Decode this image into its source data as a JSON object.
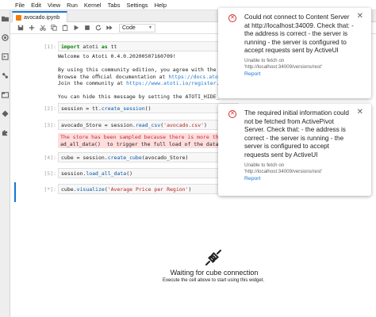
{
  "menu": [
    "File",
    "Edit",
    "View",
    "Run",
    "Kernel",
    "Tabs",
    "Settings",
    "Help"
  ],
  "tab": {
    "label": "avocado.ipynb"
  },
  "toolbar": {
    "cell_type": "Code"
  },
  "left_icons": [
    "folder-icon",
    "running-icon",
    "commands-icon",
    "property-icon",
    "tabs-icon",
    "git-icon",
    "extension-icon"
  ],
  "cells": {
    "c1": {
      "prompt": "[1]:",
      "code_kw": "import",
      "code_mod": " atoti ",
      "code_as": "as",
      "code_alias": " tt",
      "out1": "Welcome to Atoti 0.4.0.20200507160709!",
      "out2": "By using this community edition, you agree with the li",
      "out3_pre": "Browse the o",
      "out3_mid": "ﬃcial documentation at ",
      "out3_link": "https://docs.atoti",
      "out4_pre": "Join the community at ",
      "out4_link": "https://www.atoti.io/register",
      "out4_post": ".",
      "out5": "You can hide this message by setting the ATOTI_HIDE_EU"
    },
    "c2": {
      "prompt": "[2]:",
      "pre": "session = tt.",
      "fn": "create_session",
      "post": "()"
    },
    "c3": {
      "prompt": "[3]:",
      "pre": "avocado_Store = session.",
      "fn": "read_csv",
      "open": "(",
      "str": "'avocado.csv'",
      "close": ")",
      "err1": "The store has been sampled because there is more than",
      "err2": "ad_all_data()  to trigger the full load of the data."
    },
    "c4": {
      "prompt": "[4]:",
      "pre": "cube = session.",
      "fn": "create_cube",
      "post": "(avocado_Store)"
    },
    "c5": {
      "prompt": "[5]:",
      "pre": "session.",
      "fn": "load_all_data",
      "post": "()"
    },
    "c6": {
      "prompt": "[*]:",
      "pre": "cube.",
      "fn": "visualize",
      "open": "(",
      "str": "'Average Price per Region'",
      "close": ")"
    }
  },
  "placeholder": {
    "title": "Waiting for cube connection",
    "subtitle": "Execute the cell above to start using this widget."
  },
  "notifications": [
    {
      "message": "Could not connect to Content Server at http://localhost:34009. Check that: - the address is correct - the server is running - the server is configured to accept requests sent by ActiveUI",
      "detail1": "Unable to fetch on",
      "detail2": "'http://localhost:34009/versions/rest'",
      "link": "Report"
    },
    {
      "message": "The required initial information could not be fetched from ActivePivot Server. Check that: - the address is correct - the server is running - the server is configured to accept requests sent by ActiveUI",
      "detail1": "Unable to fetch on",
      "detail2": "'http://localhost:34009/versions/rest'",
      "link": "Report"
    }
  ],
  "colors": {
    "accent": "#1976d2",
    "error": "#d32f2f",
    "stderr_bg": "#ffdddd"
  }
}
